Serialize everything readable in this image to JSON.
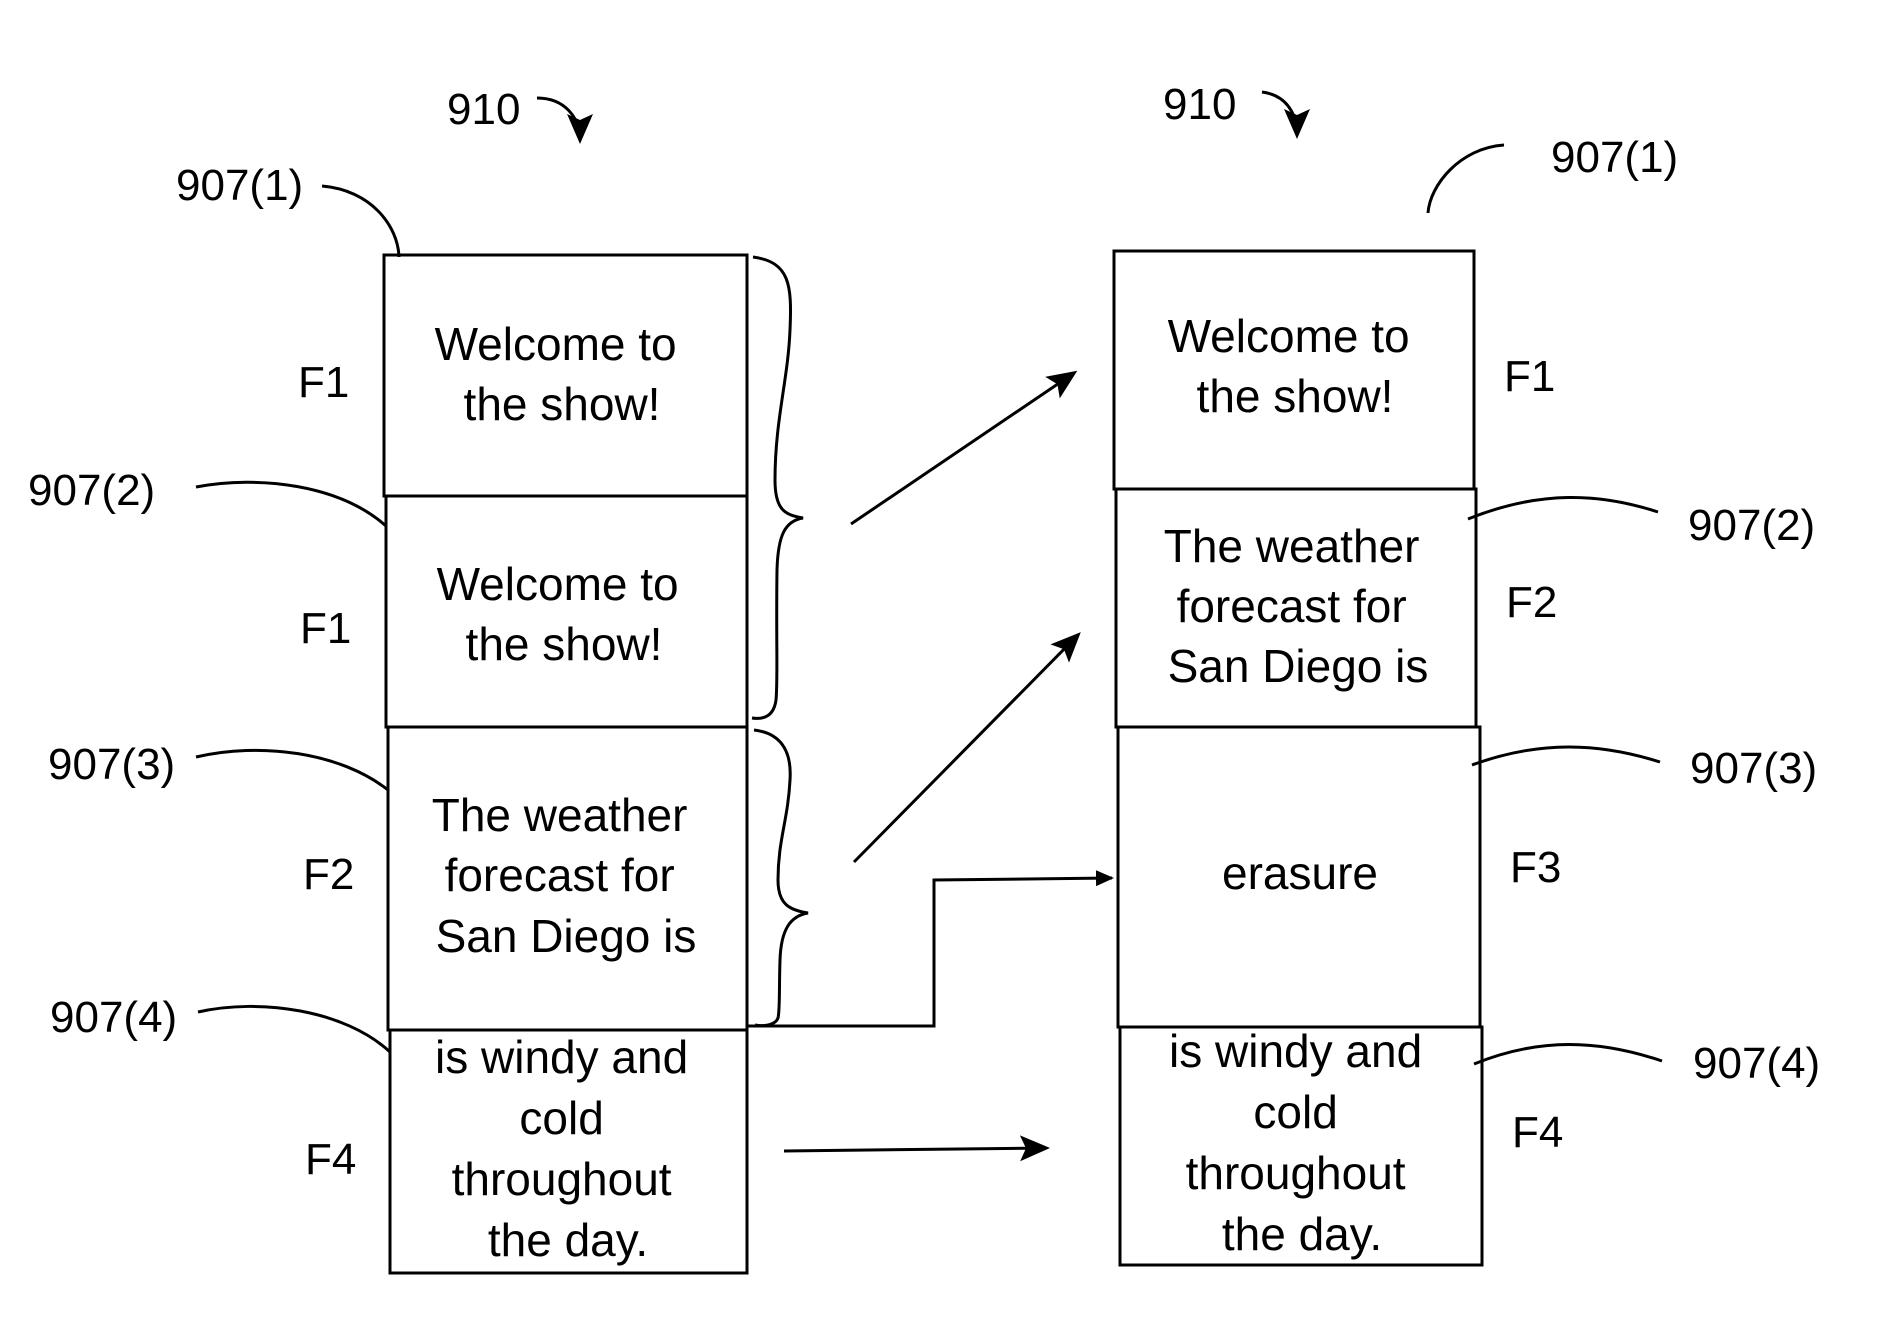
{
  "figure": {
    "group_ref": "910",
    "left_column": {
      "ref": "910",
      "frames": [
        {
          "ref": "907(1)",
          "label": "F1",
          "lines": [
            "Welcome to",
            "the show!"
          ]
        },
        {
          "ref": "907(2)",
          "label": "F1",
          "lines": [
            "Welcome to",
            "the show!"
          ]
        },
        {
          "ref": "907(3)",
          "label": "F2",
          "lines": [
            "The weather",
            "forecast for",
            "San Diego is"
          ]
        },
        {
          "ref": "907(4)",
          "label": "F4",
          "lines": [
            "is windy and",
            "cold",
            "throughout",
            "the day."
          ]
        }
      ]
    },
    "right_column": {
      "ref": "910",
      "frames": [
        {
          "ref": "907(1)",
          "label": "F1",
          "lines": [
            "Welcome to",
            "the show!"
          ]
        },
        {
          "ref": "907(2)",
          "label": "F2",
          "lines": [
            "The weather",
            "forecast for",
            "San Diego is"
          ]
        },
        {
          "ref": "907(3)",
          "label": "F3",
          "lines": [
            "erasure"
          ]
        },
        {
          "ref": "907(4)",
          "label": "F4",
          "lines": [
            "is windy and",
            "cold",
            "throughout",
            "the day."
          ]
        }
      ]
    },
    "connections": [
      {
        "from": "left brace frames 1-2",
        "to": "right frame 1",
        "type": "arrow"
      },
      {
        "from": "left brace frame 3",
        "to": "right frame 2",
        "type": "arrow"
      },
      {
        "from": "left frame 3/4 boundary",
        "to": "right frame 3",
        "type": "elbow-arrow"
      },
      {
        "from": "left frame 4",
        "to": "right frame 4",
        "type": "arrow"
      }
    ]
  }
}
